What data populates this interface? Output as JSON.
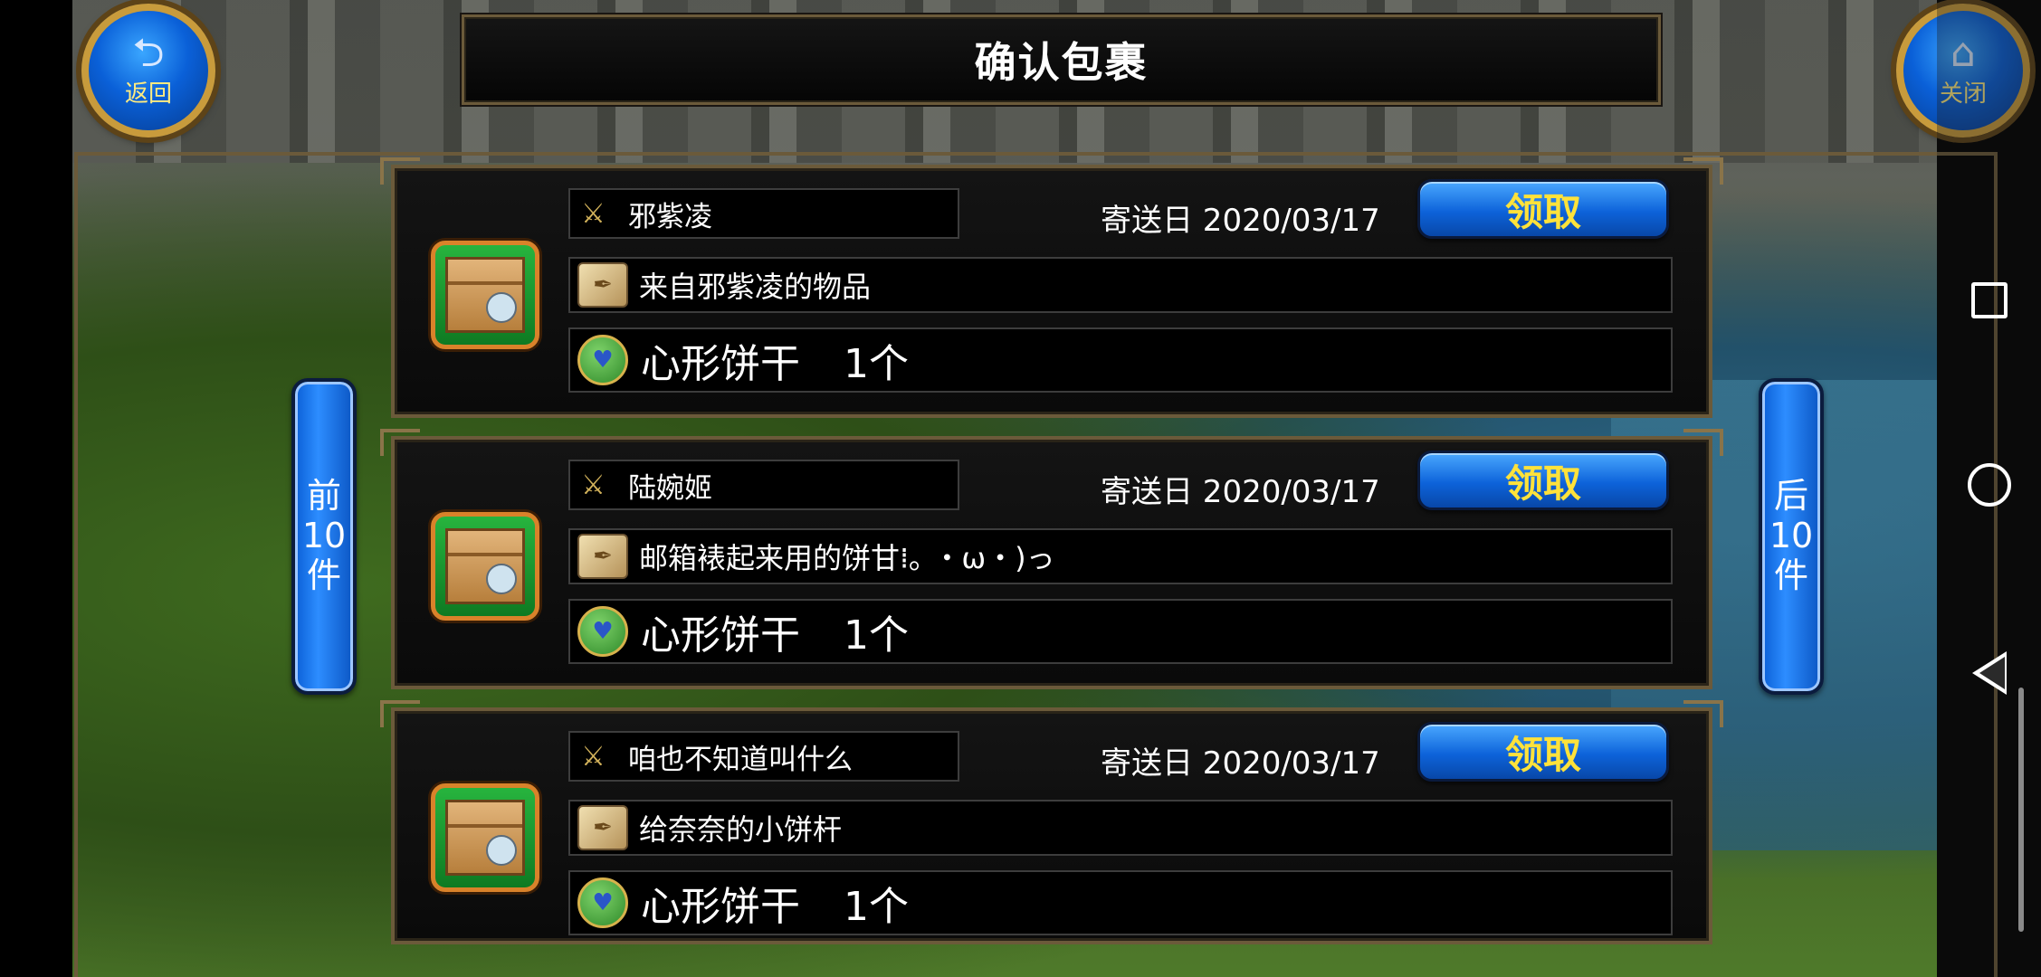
{
  "window": {
    "title": "确认包裹"
  },
  "corner_buttons": {
    "back_label": "返回",
    "back_icon": "back-arrow-icon",
    "close_label": "关闭",
    "close_icon": "home-icon"
  },
  "pagination": {
    "prev": [
      "前",
      "10",
      "件"
    ],
    "next": [
      "后",
      "10",
      "件"
    ]
  },
  "parcels": [
    {
      "sender": "邪紫凌",
      "date_label": "寄送日 2020/03/17",
      "claim_label": "领取",
      "message": "来自邪紫凌的物品",
      "item_name": "心形饼干",
      "item_qty": "1个"
    },
    {
      "sender": "陆婉姬",
      "date_label": "寄送日 2020/03/17",
      "claim_label": "领取",
      "message": "邮箱裱起来用的饼甘⁞｡ ・ω・)っ",
      "item_name": "心形饼干",
      "item_qty": "1个"
    },
    {
      "sender": "咱也不知道叫什么",
      "date_label": "寄送日 2020/03/17",
      "claim_label": "领取",
      "message": "给奈奈的小饼杆",
      "item_name": "心形饼干",
      "item_qty": "1个"
    }
  ],
  "icons": {
    "sender": "sword-shield-icon",
    "message": "scroll-quill-icon",
    "item": "cookie-item-icon",
    "package": "package-box-icon"
  },
  "colors": {
    "claim_text": "#ffe23a",
    "button_blue": "#0d63da",
    "frame_gold": "#6b5a3a"
  }
}
